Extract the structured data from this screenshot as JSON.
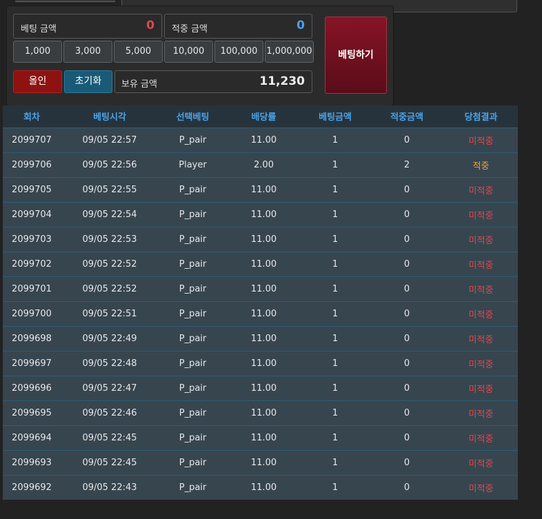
{
  "colors": {
    "bet_amount": "#e0484f",
    "hit_amount": "#4a9ef0",
    "header_text": "#4aa3e8",
    "miss": "#e0484f",
    "hit": "#f0a640"
  },
  "panel": {
    "bet_amount_label": "베팅 금액",
    "bet_amount_value": "0",
    "hit_amount_label": "적중 금액",
    "hit_amount_value": "0",
    "chips": [
      "1,000",
      "3,000",
      "5,000",
      "10,000",
      "100,000",
      "1,000,000"
    ],
    "allin_label": "올인",
    "reset_label": "초기화",
    "balance_label": "보유 금액",
    "balance_value": "11,230",
    "bet_button_label": "베팅하기"
  },
  "table": {
    "headers": [
      "회차",
      "베팅시각",
      "선택베팅",
      "배당률",
      "베팅금액",
      "적중금액",
      "당첨결과"
    ],
    "rows": [
      [
        "2099707",
        "09/05 22:57",
        "P_pair",
        "11.00",
        "1",
        "0",
        "미적중"
      ],
      [
        "2099706",
        "09/05 22:56",
        "Player",
        "2.00",
        "1",
        "2",
        "적중"
      ],
      [
        "2099705",
        "09/05 22:55",
        "P_pair",
        "11.00",
        "1",
        "0",
        "미적중"
      ],
      [
        "2099704",
        "09/05 22:54",
        "P_pair",
        "11.00",
        "1",
        "0",
        "미적중"
      ],
      [
        "2099703",
        "09/05 22:53",
        "P_pair",
        "11.00",
        "1",
        "0",
        "미적중"
      ],
      [
        "2099702",
        "09/05 22:52",
        "P_pair",
        "11.00",
        "1",
        "0",
        "미적중"
      ],
      [
        "2099701",
        "09/05 22:52",
        "P_pair",
        "11.00",
        "1",
        "0",
        "미적중"
      ],
      [
        "2099700",
        "09/05 22:51",
        "P_pair",
        "11.00",
        "1",
        "0",
        "미적중"
      ],
      [
        "2099698",
        "09/05 22:49",
        "P_pair",
        "11.00",
        "1",
        "0",
        "미적중"
      ],
      [
        "2099697",
        "09/05 22:48",
        "P_pair",
        "11.00",
        "1",
        "0",
        "미적중"
      ],
      [
        "2099696",
        "09/05 22:47",
        "P_pair",
        "11.00",
        "1",
        "0",
        "미적중"
      ],
      [
        "2099695",
        "09/05 22:46",
        "P_pair",
        "11.00",
        "1",
        "0",
        "미적중"
      ],
      [
        "2099694",
        "09/05 22:45",
        "P_pair",
        "11.00",
        "1",
        "0",
        "미적중"
      ],
      [
        "2099693",
        "09/05 22:45",
        "P_pair",
        "11.00",
        "1",
        "0",
        "미적중"
      ],
      [
        "2099692",
        "09/05 22:43",
        "P_pair",
        "11.00",
        "1",
        "0",
        "미적중"
      ]
    ]
  }
}
